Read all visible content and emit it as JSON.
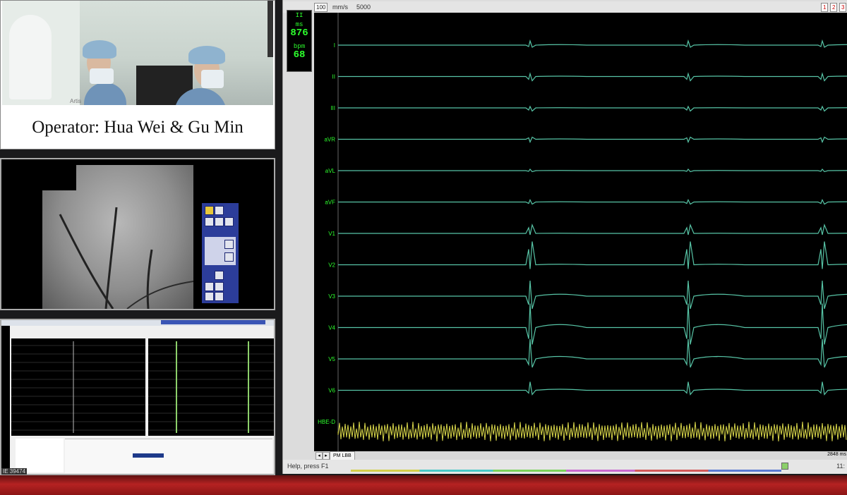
{
  "video": {
    "caption": "Operator: Hua Wei & Gu Min",
    "bg_equipment_label": "Artis"
  },
  "fluoro": {},
  "mini_lab": {
    "top_tabs": [
      "",
      ""
    ]
  },
  "main": {
    "toolbar": {
      "speed_value": "100",
      "speed_unit": "mm/s",
      "range_label": "5000",
      "page_buttons": [
        "1",
        "2",
        "3"
      ]
    },
    "hr": {
      "unit_label": "ms",
      "cycle_length": "876",
      "bpm_label": "bpm",
      "rate": "68",
      "top_label": "II"
    },
    "channels": [
      "I",
      "II",
      "III",
      "aVR",
      "aVL",
      "aVF",
      "V1",
      "V2",
      "V3",
      "V4",
      "V5",
      "V6",
      "HBE-D"
    ],
    "bottom": {
      "page_label": "PM LBB",
      "right_value": "2848 ms"
    },
    "status": {
      "help_text": "Help, press F1",
      "time_text": "11:"
    },
    "colors": {
      "ecg_trace": "#57c4a6",
      "hbe_trace": "#d8d64a",
      "label_green": "#2dff2d",
      "trace_bg": "#000000"
    }
  },
  "footer": {
    "left_tag": "IE 39474"
  }
}
